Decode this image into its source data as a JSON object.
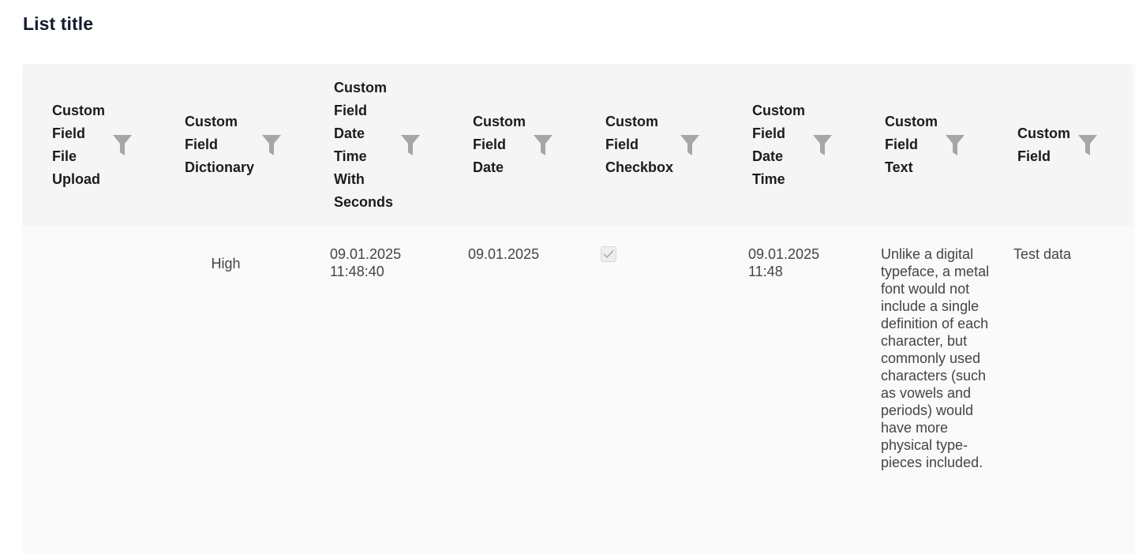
{
  "list": {
    "title": "List title"
  },
  "table": {
    "columns": [
      {
        "label": "Custom\nField\nFile\nUpload",
        "filter_icon": "filter-icon"
      },
      {
        "label": "Custom\nField\nDictionary",
        "filter_icon": "filter-icon"
      },
      {
        "label": "Custom\nField\nDate\nTime\nWith\nSeconds",
        "filter_icon": "filter-icon"
      },
      {
        "label": "Custom\nField\nDate",
        "filter_icon": "filter-icon"
      },
      {
        "label": "Custom\nField\nCheckbox",
        "filter_icon": "filter-icon"
      },
      {
        "label": "Custom\nField\nDate\nTime",
        "filter_icon": "filter-icon"
      },
      {
        "label": "Custom\nField\nText",
        "filter_icon": "filter-icon"
      },
      {
        "label": "Custom\nField",
        "filter_icon": "filter-icon"
      }
    ],
    "rows": [
      {
        "file_upload": "",
        "dictionary": "High",
        "date_time_seconds": "09.01.2025\n11:48:40",
        "date": "09.01.2025",
        "checkbox_checked": true,
        "date_time": "09.01.2025\n11:48",
        "text": "Unlike a digital typeface, a metal font would not include a single definition of each character, but commonly used characters (such as vowels and periods) would have more physical type-pieces included.",
        "field": "Test data"
      }
    ]
  },
  "colors": {
    "header_bg": "#f5f5f5",
    "row_bg": "#fafafa",
    "filter_icon": "#a6a6a6",
    "title": "#131c2b"
  }
}
